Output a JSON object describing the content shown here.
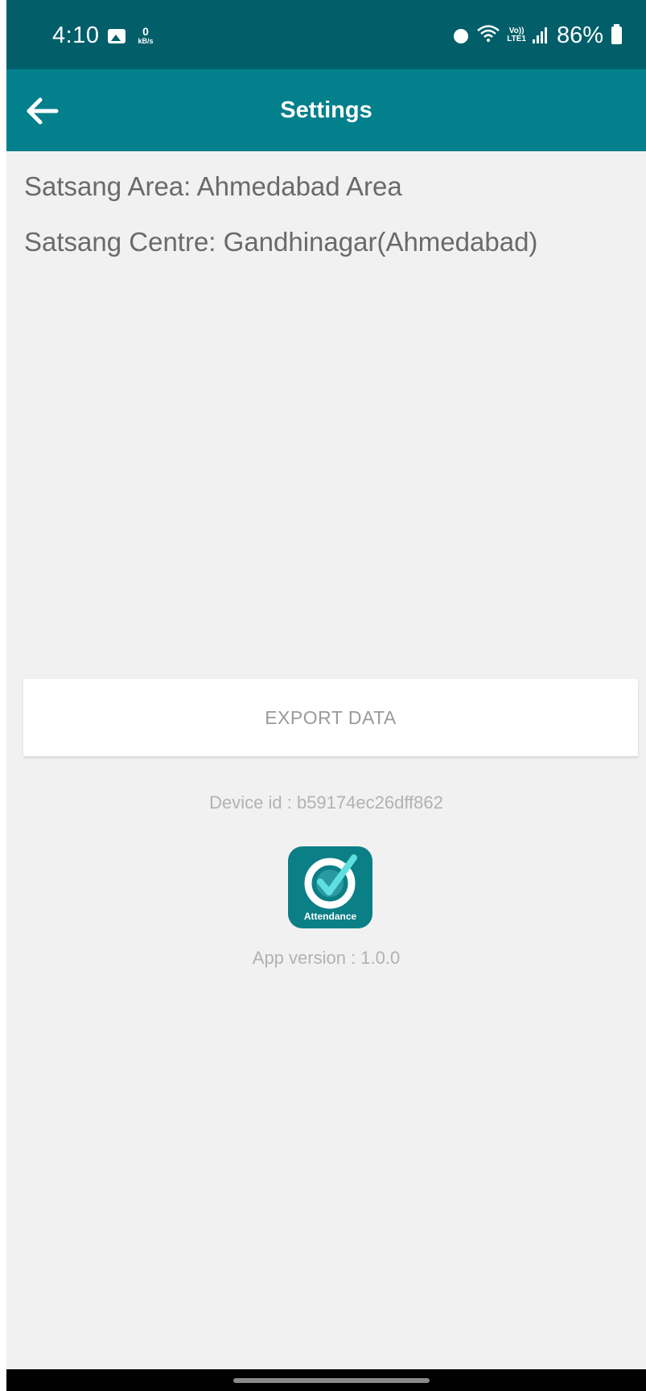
{
  "status_bar": {
    "time": "4:10",
    "net_speed_value": "0",
    "net_speed_unit": "kB/s",
    "volte_top": "Vo))",
    "volte_bottom": "LTE1",
    "battery": "86%"
  },
  "app_bar": {
    "title": "Settings"
  },
  "info": {
    "area": "Satsang Area: Ahmedabad Area",
    "centre": "Satsang Centre: Gandhinagar(Ahmedabad)"
  },
  "actions": {
    "export_label": "EXPORT DATA"
  },
  "device": {
    "id_text": "Device id : b59174ec26dff862"
  },
  "app": {
    "logo_text": "Attendance",
    "version_text": "App version : 1.0.0"
  },
  "colors": {
    "status_bar": "#025f6a",
    "app_bar": "#02808b",
    "background": "#f2f1f2",
    "logo": "#0b7f86"
  },
  "icons": [
    "gallery-icon",
    "alarm-icon",
    "wifi-icon",
    "signal-icon",
    "battery-icon",
    "back-arrow-icon",
    "attendance-logo-icon"
  ]
}
